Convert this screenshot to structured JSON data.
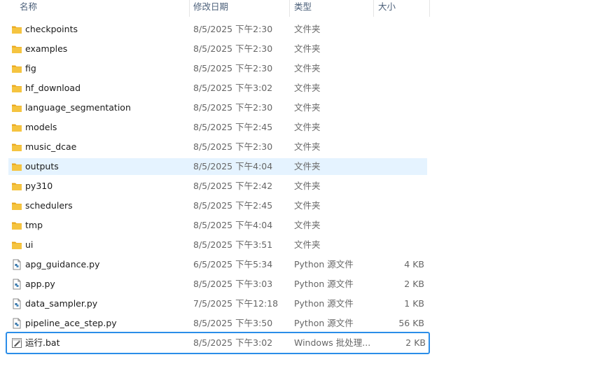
{
  "columns": {
    "name": "名称",
    "date": "修改日期",
    "type": "类型",
    "size": "大小"
  },
  "files": [
    {
      "name": "checkpoints",
      "date": "8/5/2025 下午2:30",
      "type": "文件夹",
      "size": "",
      "icon": "folder-icon"
    },
    {
      "name": "examples",
      "date": "8/5/2025 下午2:30",
      "type": "文件夹",
      "size": "",
      "icon": "folder-icon"
    },
    {
      "name": "fig",
      "date": "8/5/2025 下午2:30",
      "type": "文件夹",
      "size": "",
      "icon": "folder-icon"
    },
    {
      "name": "hf_download",
      "date": "8/5/2025 下午3:02",
      "type": "文件夹",
      "size": "",
      "icon": "folder-icon"
    },
    {
      "name": "language_segmentation",
      "date": "8/5/2025 下午2:30",
      "type": "文件夹",
      "size": "",
      "icon": "folder-icon"
    },
    {
      "name": "models",
      "date": "8/5/2025 下午2:45",
      "type": "文件夹",
      "size": "",
      "icon": "folder-icon"
    },
    {
      "name": "music_dcae",
      "date": "8/5/2025 下午2:30",
      "type": "文件夹",
      "size": "",
      "icon": "folder-icon"
    },
    {
      "name": "outputs",
      "date": "8/5/2025 下午4:04",
      "type": "文件夹",
      "size": "",
      "icon": "folder-icon"
    },
    {
      "name": "py310",
      "date": "8/5/2025 下午2:42",
      "type": "文件夹",
      "size": "",
      "icon": "folder-icon"
    },
    {
      "name": "schedulers",
      "date": "8/5/2025 下午2:45",
      "type": "文件夹",
      "size": "",
      "icon": "folder-icon"
    },
    {
      "name": "tmp",
      "date": "8/5/2025 下午4:04",
      "type": "文件夹",
      "size": "",
      "icon": "folder-icon"
    },
    {
      "name": "ui",
      "date": "8/5/2025 下午3:51",
      "type": "文件夹",
      "size": "",
      "icon": "folder-icon"
    },
    {
      "name": "apg_guidance.py",
      "date": "6/5/2025 下午5:34",
      "type": "Python 源文件",
      "size": "4 KB",
      "icon": "python-file-icon"
    },
    {
      "name": "app.py",
      "date": "8/5/2025 下午3:03",
      "type": "Python 源文件",
      "size": "2 KB",
      "icon": "python-file-icon"
    },
    {
      "name": "data_sampler.py",
      "date": "7/5/2025 下午12:18",
      "type": "Python 源文件",
      "size": "1 KB",
      "icon": "python-file-icon"
    },
    {
      "name": "pipeline_ace_step.py",
      "date": "8/5/2025 下午3:50",
      "type": "Python 源文件",
      "size": "56 KB",
      "icon": "python-file-icon"
    },
    {
      "name": "运行.bat",
      "date": "8/5/2025 下午3:02",
      "type": "Windows 批处理...",
      "size": "2 KB",
      "icon": "batch-file-icon"
    }
  ],
  "selected_row": "outputs",
  "focused_row": "运行.bat",
  "colors": {
    "selection": "#e5f3ff",
    "focus_border": "#2b8de8",
    "folder": "#f5c440"
  }
}
